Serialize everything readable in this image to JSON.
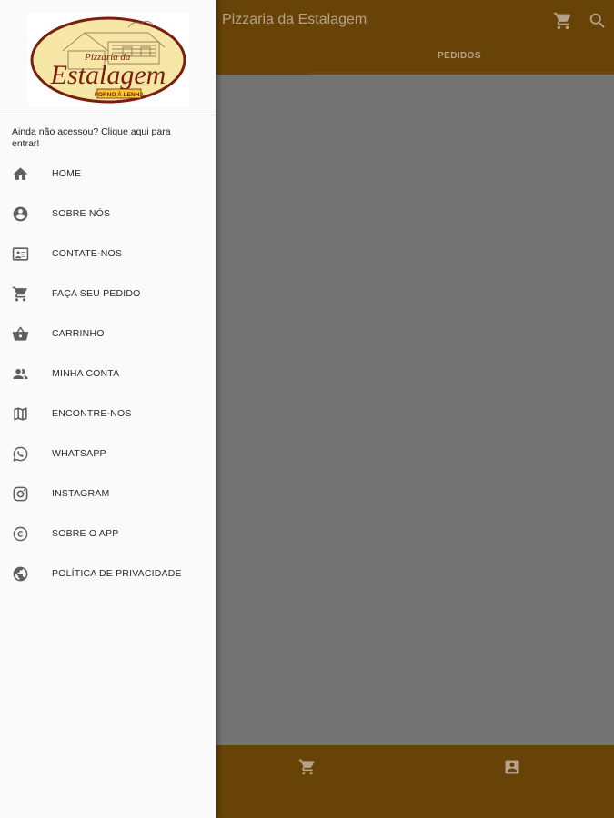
{
  "app": {
    "title": "Pizzaria da Estalagem"
  },
  "tabs": [
    {
      "label": "PEDIDOS"
    }
  ],
  "logo": {
    "name_line1": "Pizzaria da",
    "name_line2": "Estalagem",
    "tagline": "FORNO À LENHA"
  },
  "drawer": {
    "login_hint": "Ainda não acessou? Clique aqui para entrar!",
    "items": [
      {
        "label": "HOME",
        "icon": "home-icon"
      },
      {
        "label": "SOBRE NÓS",
        "icon": "account-circle-icon"
      },
      {
        "label": "CONTATE-NOS",
        "icon": "contact-card-icon"
      },
      {
        "label": "FAÇA SEU PEDIDO",
        "icon": "cart-icon"
      },
      {
        "label": "CARRINHO",
        "icon": "basket-icon"
      },
      {
        "label": "MINHA CONTA",
        "icon": "people-icon"
      },
      {
        "label": "ENCONTRE-NOS",
        "icon": "map-icon"
      },
      {
        "label": "WHATSAPP",
        "icon": "whatsapp-icon"
      },
      {
        "label": "INSTAGRAM",
        "icon": "instagram-icon"
      },
      {
        "label": "SOBRE O APP",
        "icon": "copyright-icon"
      },
      {
        "label": "POLÍTICA DE PRIVACIDADE",
        "icon": "globe-icon"
      }
    ]
  },
  "colors": {
    "primary": "#684308",
    "overlay": "#737373",
    "drawer_bg": "#fafafa",
    "logo_brown": "#7a1f10",
    "logo_yellow": "#f6e7a6"
  }
}
